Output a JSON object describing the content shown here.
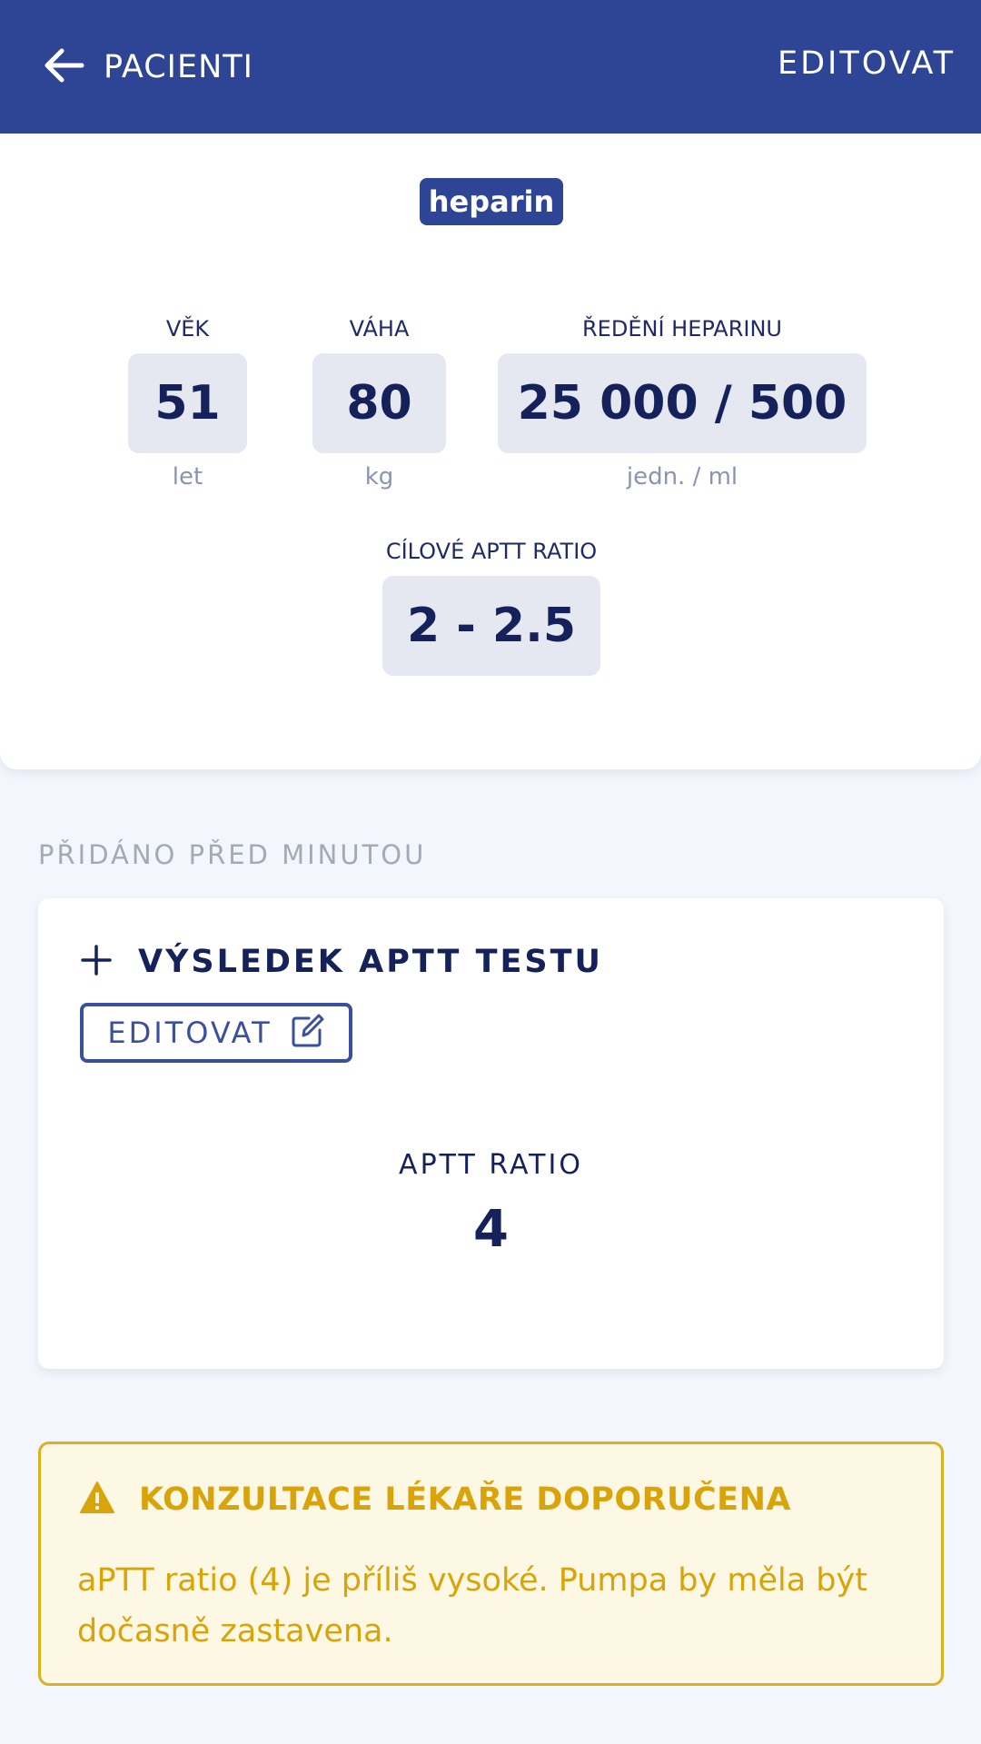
{
  "appbar": {
    "back_label": "PACIENTI",
    "edit_label": "EDITOVAT"
  },
  "patient": {
    "drug": "heparin",
    "age": {
      "label": "VĚK",
      "value": "51",
      "unit": "let"
    },
    "weight": {
      "label": "VÁHA",
      "value": "80",
      "unit": "kg"
    },
    "dilution": {
      "label": "ŘEDĚNÍ HEPARINU",
      "value": "25 000 / 500",
      "unit": "jedn. / ml"
    },
    "target": {
      "label": "CÍLOVÉ APTT RATIO",
      "value": "2 - 2.5"
    }
  },
  "entry": {
    "added_label": "PŘIDÁNO PŘED MINUTOU",
    "title": "VÝSLEDEK APTT TESTU",
    "edit_label": "EDITOVAT",
    "ratio_label": "APTT RATIO",
    "ratio_value": "4"
  },
  "warning": {
    "title": "KONZULTACE LÉKAŘE DOPORUČENA",
    "text": "aPTT ratio (4) je příliš vysoké. Pumpa by měla být dočasně zastavena."
  },
  "colors": {
    "primary": "#2e4596",
    "text_dark": "#14215a",
    "warning": "#d9a30a",
    "warning_bg": "#fdf8e4",
    "background": "#f3f6fc"
  },
  "icons": {
    "back": "arrow-left-icon",
    "add": "plus-icon",
    "edit": "edit-icon",
    "warning": "warning-icon"
  }
}
